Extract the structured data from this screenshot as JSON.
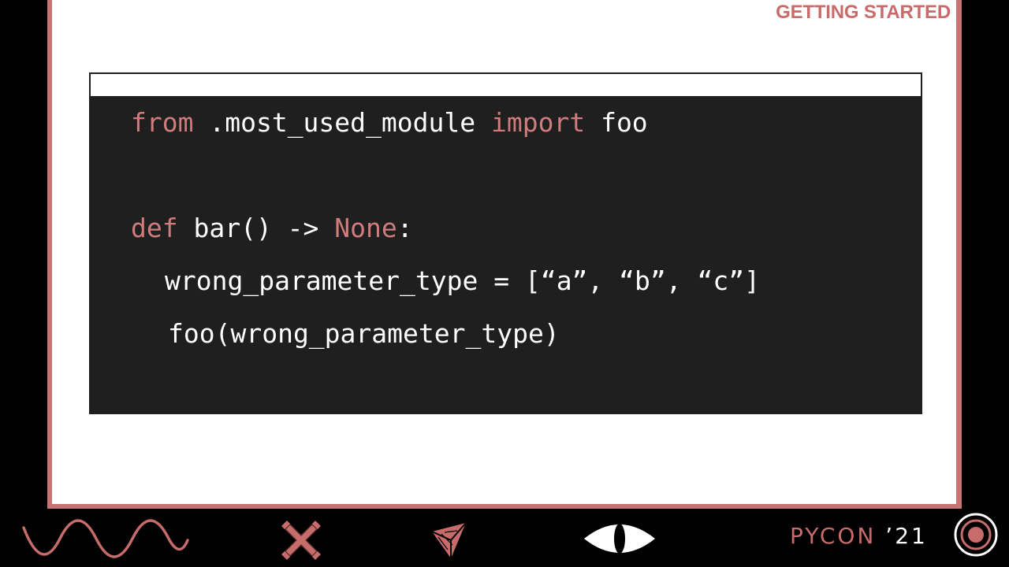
{
  "header": {
    "section_title": "GETTING STARTED"
  },
  "code": {
    "line1": {
      "kw1": "from",
      "mid": " .most_used_module ",
      "kw2": "import",
      "end": " foo"
    },
    "line2": {
      "kw1": "def",
      "mid": " bar() -> ",
      "kw2": "None",
      "end": ":"
    },
    "line3": "wrong_parameter_type = [“a”, “b”, “c”]",
    "line4": "foo(wrong_parameter_type)"
  },
  "footer": {
    "brand": "PYCON",
    "year": "’21",
    "icons": [
      "wave-icon",
      "x-cross-icon",
      "paper-plane-icon",
      "eye-icon",
      "target-circle-icon"
    ]
  },
  "colors": {
    "accent": "#c76b6b",
    "code_bg": "#1f1f1f",
    "keyword": "#d07c7c",
    "background": "#000000"
  }
}
